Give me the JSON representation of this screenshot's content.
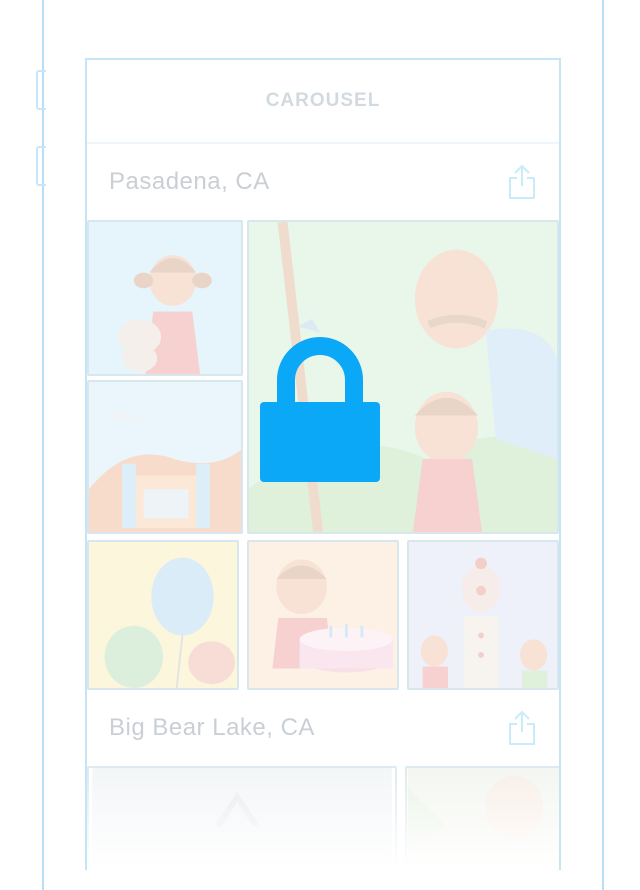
{
  "nav": {
    "title": "CAROUSEL"
  },
  "sections": [
    {
      "title": "Pasadena, CA",
      "share_icon": "share-icon"
    },
    {
      "title": "Big Bear Lake, CA",
      "share_icon": "share-icon"
    }
  ],
  "overlay": {
    "icon": "lock-icon",
    "color": "#0aa8f7"
  },
  "colors": {
    "outline": "#b9dff5",
    "accent": "#0aa8f7"
  }
}
